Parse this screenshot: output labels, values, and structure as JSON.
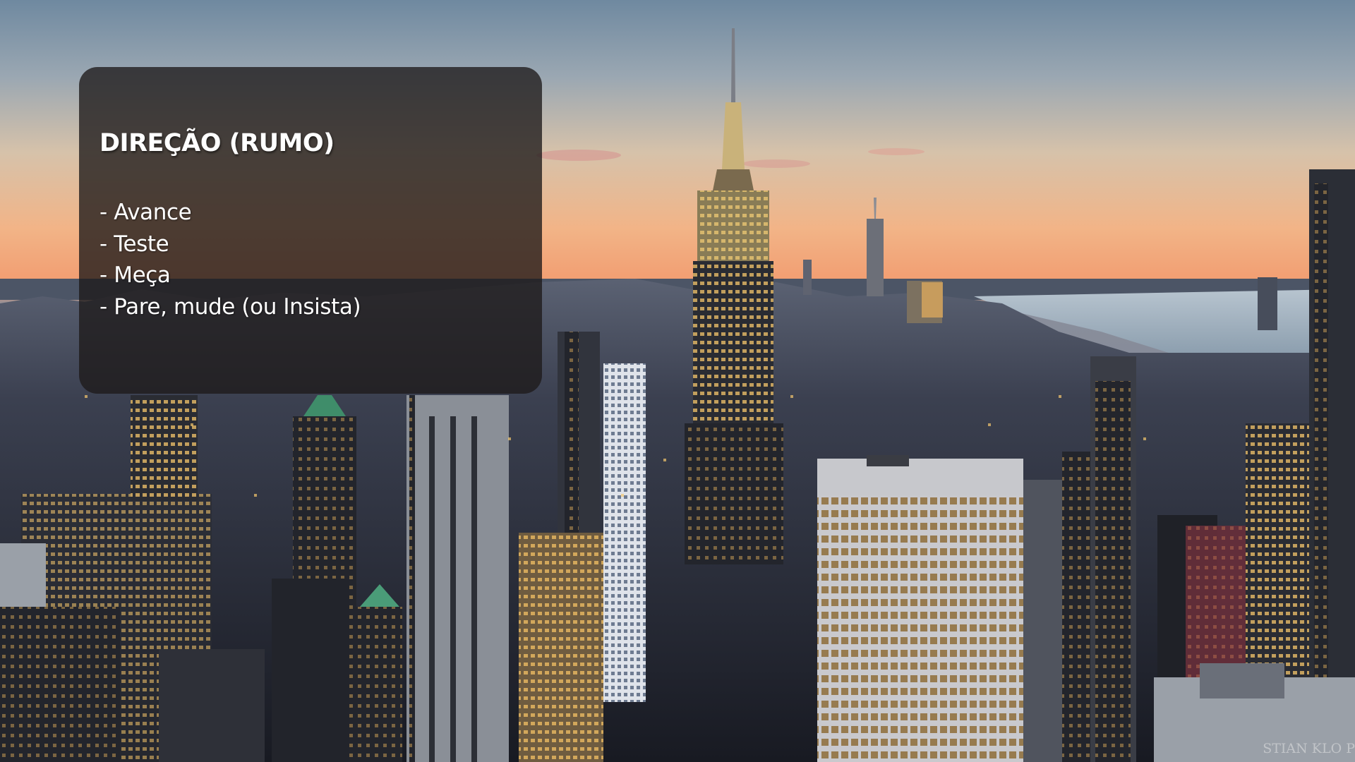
{
  "panel": {
    "title": "DIREÇÃO (RUMO)",
    "items": [
      "- Avance",
      "- Teste",
      "- Meça",
      "- Pare, mude (ou Insista)"
    ]
  },
  "photo_credit": "STIAN KLO P",
  "colors": {
    "panel_background": "#1e1a1a",
    "panel_text": "#ffffff",
    "sky_top": "#6f89a0",
    "sky_horizon": "#f29a6e",
    "river": "#9fb3c4",
    "window_light": "#f4c56a"
  }
}
